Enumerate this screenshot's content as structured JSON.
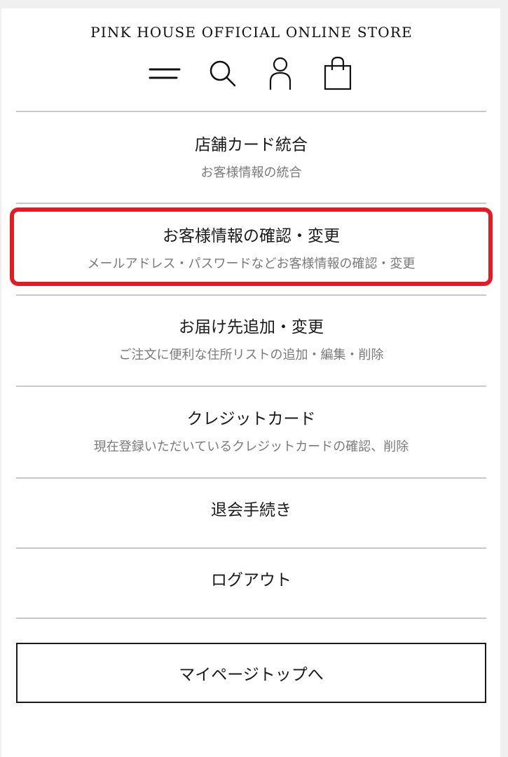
{
  "header": {
    "store_title": "PINK HOUSE OFFICIAL ONLINE STORE",
    "icons": [
      "menu-icon",
      "search-icon",
      "user-icon",
      "shopping-bag-icon"
    ]
  },
  "menu": {
    "items": [
      {
        "title": "店舗カード統合",
        "subtitle": "お客様情報の統合"
      },
      {
        "title": "お客様情報の確認・変更",
        "subtitle": "メールアドレス・パスワードなどお客様情報の確認・変更"
      },
      {
        "title": "お届け先追加・変更",
        "subtitle": "ご注文に便利な住所リストの追加・編集・削除"
      },
      {
        "title": "クレジットカード",
        "subtitle": "現在登録いただいているクレジットカードの確認、削除"
      },
      {
        "title": "退会手続き"
      },
      {
        "title": "ログアウト"
      }
    ]
  },
  "mypage_button_label": "マイページトップへ",
  "colors": {
    "highlight": "#e21b24",
    "divider": "#c8c8c8",
    "subtitle": "#7a7a7a"
  }
}
